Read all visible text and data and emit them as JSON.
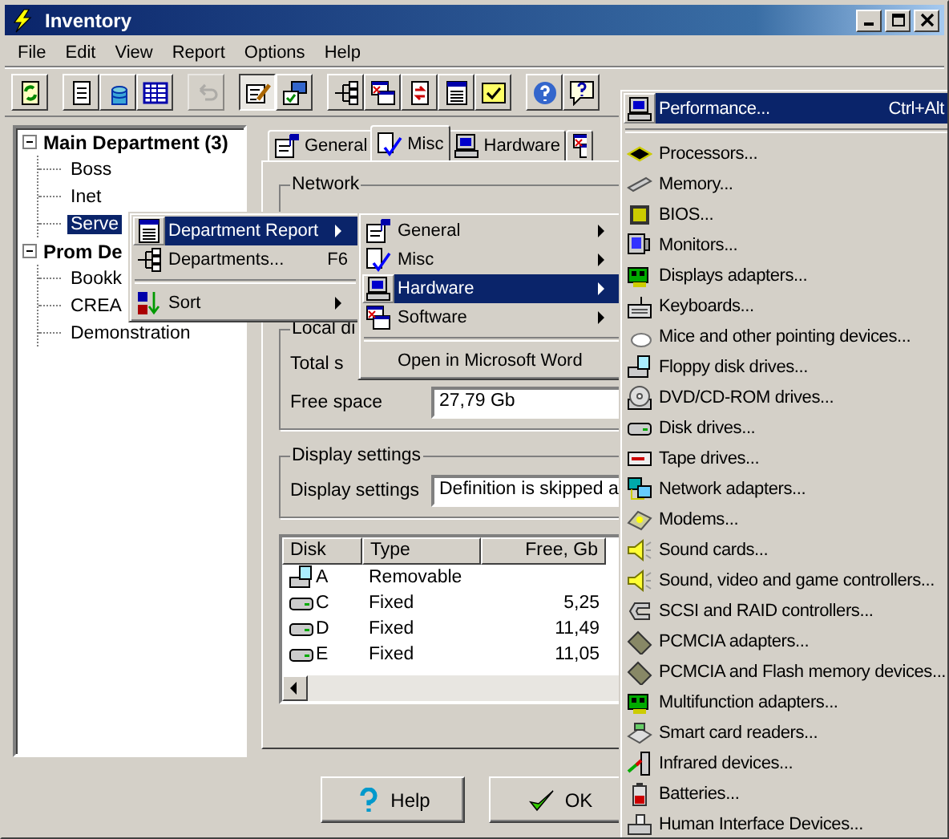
{
  "window": {
    "title": "Inventory"
  },
  "menu_bar": [
    "File",
    "Edit",
    "View",
    "Report",
    "Options",
    "Help"
  ],
  "toolbar": [
    {
      "buttons": [
        {
          "pressed": false,
          "disabled": false
        }
      ]
    },
    {
      "buttons": [
        {
          "pressed": false,
          "disabled": false
        },
        {
          "pressed": false,
          "disabled": false
        },
        {
          "pressed": false,
          "disabled": false
        }
      ]
    },
    {
      "buttons": [
        {
          "pressed": false,
          "disabled": true
        }
      ]
    },
    {
      "buttons": [
        {
          "pressed": true,
          "disabled": false
        },
        {
          "pressed": false,
          "disabled": false
        }
      ]
    },
    {
      "buttons": [
        {
          "pressed": false,
          "disabled": false
        },
        {
          "pressed": false,
          "disabled": false
        },
        {
          "pressed": false,
          "disabled": false
        },
        {
          "pressed": false,
          "disabled": false
        },
        {
          "pressed": false,
          "disabled": false
        }
      ]
    },
    {
      "buttons": [
        {
          "pressed": false,
          "disabled": false
        },
        {
          "pressed": false,
          "disabled": false
        }
      ]
    }
  ],
  "tree": [
    {
      "label": "Main Department (3)",
      "expanded": true,
      "children": [
        {
          "label": "Boss",
          "selected": false
        },
        {
          "label": "Inet",
          "selected": false
        },
        {
          "label": "Serve",
          "selected": true
        }
      ]
    },
    {
      "label": "Prom De",
      "expanded": true,
      "children": [
        {
          "label": "Bookk",
          "selected": false
        },
        {
          "label": "CREA",
          "selected": false
        },
        {
          "label": "Demonstration",
          "selected": false
        }
      ]
    }
  ],
  "tabs": [
    {
      "label": "General",
      "selected": false
    },
    {
      "label": "Misc",
      "selected": true
    },
    {
      "label": "Hardware",
      "selected": false
    },
    {
      "selected": false
    }
  ],
  "groups": [
    {
      "title": "Network"
    },
    {
      "title": "Local di",
      "fields": [
        {
          "label": "Total s"
        },
        {
          "label": "Free space",
          "value": "27,79 Gb"
        }
      ]
    },
    {
      "title": "Display settings",
      "fields": [
        {
          "label": "Display settings",
          "value": "Definition is skipped a"
        }
      ]
    }
  ],
  "disks": {
    "columns": [
      "Disk",
      "Type",
      "Free, Gb"
    ],
    "rows": [
      {
        "kind": "floppy",
        "disk": "A",
        "type": "Removable"
      },
      {
        "kind": "drive",
        "disk": "C",
        "type": "Fixed",
        "free": "5,25"
      },
      {
        "kind": "drive",
        "disk": "D",
        "type": "Fixed",
        "free": "11,49"
      },
      {
        "kind": "drive",
        "disk": "E",
        "type": "Fixed",
        "free": "11,05"
      }
    ]
  },
  "buttons": [
    {
      "label": "Help"
    },
    {
      "label": "OK"
    }
  ],
  "context_menus": [
    {
      "items": [
        {
          "kind": "item",
          "label": "Department Report",
          "submenu": true,
          "selected": true
        },
        {
          "kind": "item",
          "label": "Departments...",
          "shortcut": "F6",
          "submenu": false,
          "selected": false
        },
        {
          "kind": "separator"
        },
        {
          "kind": "item",
          "label": "Sort",
          "submenu": true,
          "selected": false
        }
      ]
    },
    {
      "items": [
        {
          "kind": "item",
          "label": "General",
          "submenu": true,
          "selected": false
        },
        {
          "kind": "item",
          "label": "Misc",
          "submenu": true,
          "selected": false
        },
        {
          "kind": "item",
          "label": "Hardware",
          "submenu": true,
          "selected": true
        },
        {
          "kind": "item",
          "label": "Software",
          "submenu": true,
          "selected": false
        },
        {
          "kind": "separator"
        },
        {
          "kind": "item",
          "label": "Open in Microsoft Word",
          "submenu": false,
          "selected": false
        }
      ]
    },
    {
      "items": [
        {
          "kind": "item",
          "label": "Performance...",
          "shortcut": "Ctrl+Alt",
          "submenu": false,
          "selected": true
        },
        {
          "kind": "separator"
        },
        {
          "kind": "item",
          "label": "Processors...",
          "submenu": false,
          "selected": false
        },
        {
          "kind": "item",
          "label": "Memory...",
          "submenu": false,
          "selected": false
        },
        {
          "kind": "item",
          "label": "BIOS...",
          "submenu": false,
          "selected": false
        },
        {
          "kind": "item",
          "label": "Monitors...",
          "submenu": false,
          "selected": false
        },
        {
          "kind": "item",
          "label": "Displays adapters...",
          "submenu": false,
          "selected": false
        },
        {
          "kind": "item",
          "label": "Keyboards...",
          "submenu": false,
          "selected": false
        },
        {
          "kind": "item",
          "label": "Mice and other pointing devices...",
          "submenu": false,
          "selected": false
        },
        {
          "kind": "item",
          "label": "Floppy disk drives...",
          "submenu": false,
          "selected": false
        },
        {
          "kind": "item",
          "label": "DVD/CD-ROM drives...",
          "submenu": false,
          "selected": false
        },
        {
          "kind": "item",
          "label": "Disk drives...",
          "submenu": false,
          "selected": false
        },
        {
          "kind": "item",
          "label": "Tape drives...",
          "submenu": false,
          "selected": false
        },
        {
          "kind": "item",
          "label": "Network adapters...",
          "submenu": false,
          "selected": false
        },
        {
          "kind": "item",
          "label": "Modems...",
          "submenu": false,
          "selected": false
        },
        {
          "kind": "item",
          "label": "Sound cards...",
          "submenu": false,
          "selected": false
        },
        {
          "kind": "item",
          "label": "Sound, video and game controllers...",
          "submenu": false,
          "selected": false
        },
        {
          "kind": "item",
          "label": "SCSI and RAID controllers...",
          "submenu": false,
          "selected": false
        },
        {
          "kind": "item",
          "label": "PCMCIA adapters...",
          "submenu": false,
          "selected": false
        },
        {
          "kind": "item",
          "label": "PCMCIA and Flash memory devices...",
          "submenu": false,
          "selected": false
        },
        {
          "kind": "item",
          "label": "Multifunction adapters...",
          "submenu": false,
          "selected": false
        },
        {
          "kind": "item",
          "label": "Smart card readers...",
          "submenu": false,
          "selected": false
        },
        {
          "kind": "item",
          "label": "Infrared devices...",
          "submenu": false,
          "selected": false
        },
        {
          "kind": "item",
          "label": "Batteries...",
          "submenu": false,
          "selected": false
        },
        {
          "kind": "item",
          "label": "Human Interface Devices...",
          "submenu": false,
          "selected": false
        }
      ]
    }
  ]
}
